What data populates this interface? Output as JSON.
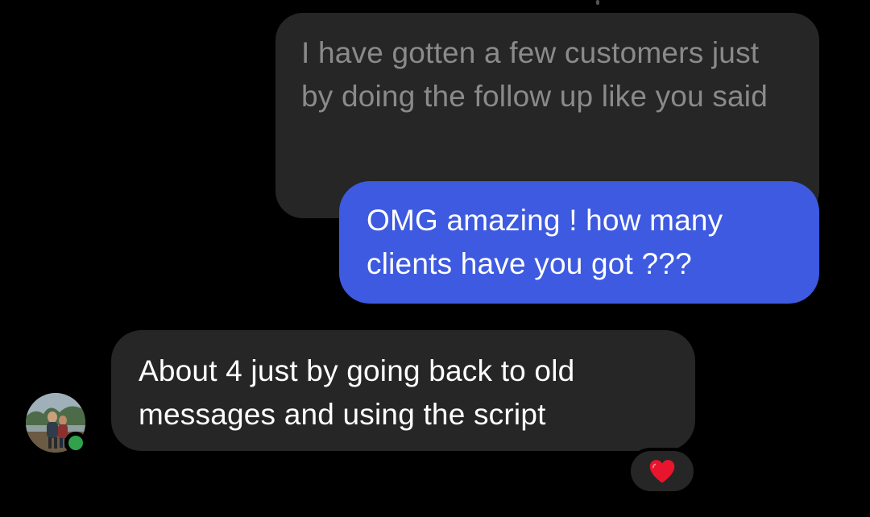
{
  "messages": {
    "quoted": {
      "text": "I have gotten a few customers just by doing the follow up like you said",
      "sender": "contact"
    },
    "sent": {
      "text": "OMG amazing ! how many clients have you got ???",
      "sender": "me"
    },
    "received": {
      "text": "About 4 just by going back to old messages and using the script",
      "sender": "contact",
      "reaction": "heart-icon"
    }
  },
  "colors": {
    "background": "#000000",
    "sent_bubble": "#3d5ae0",
    "received_bubble": "#262626",
    "quoted_text": "#8a8a8a",
    "online_status": "#31a24c",
    "reaction_heart": "#e8152c"
  },
  "contact": {
    "avatar": "avatar-photo",
    "online": true
  }
}
